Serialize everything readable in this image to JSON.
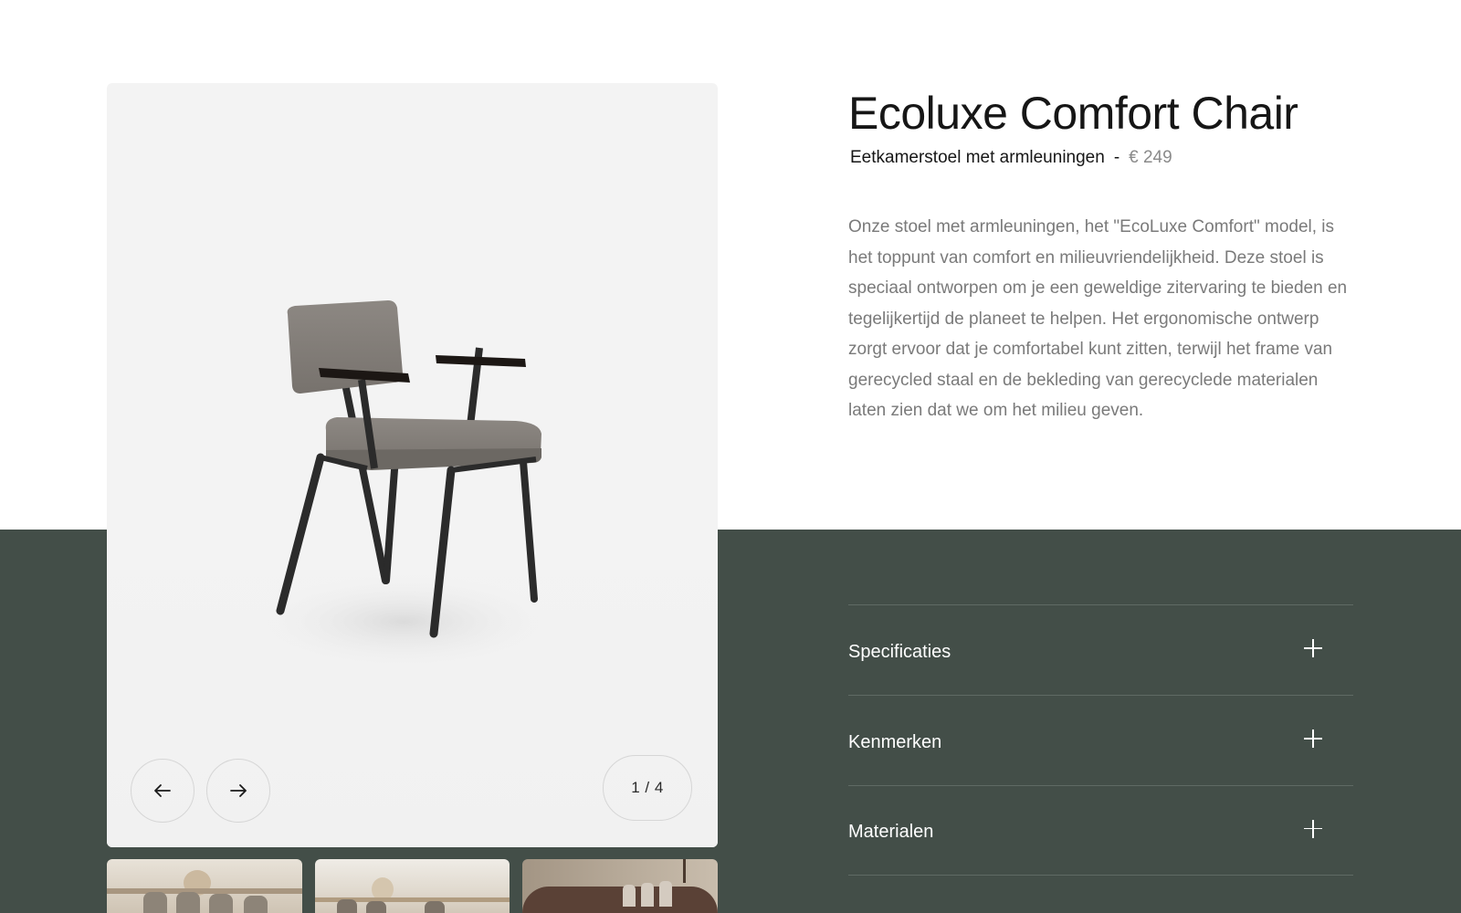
{
  "product": {
    "title": "Ecoluxe Comfort Chair",
    "subtitle": "Eetkamerstoel met armleuningen",
    "separator": "-",
    "price": "€ 249",
    "description": "Onze stoel met armleuningen, het \"EcoLuxe Comfort\" model, is het toppunt van comfort en milieuvriendelijkheid. Deze stoel is speciaal ontworpen om je een geweldige zitervaring te bieden en tegelijkertijd de planeet te helpen. Het ergonomische ontwerp zorgt ervoor dat je comfortabel kunt zitten, terwijl het frame van gerecycled staal en de bekleding van gerecyclede materialen laten zien dat we om het milieu geven."
  },
  "gallery": {
    "counter": "1 / 4",
    "prev_icon": "arrow-left-icon",
    "next_icon": "arrow-right-icon",
    "thumbnails": [
      "dining-table-scene-1",
      "dining-table-scene-2",
      "dining-table-scene-3"
    ]
  },
  "accordion": {
    "items": [
      {
        "label": "Specificaties",
        "icon": "plus-icon"
      },
      {
        "label": "Kenmerken",
        "icon": "plus-icon"
      },
      {
        "label": "Materialen",
        "icon": "plus-icon"
      }
    ]
  },
  "colors": {
    "accent_band": "#434e48",
    "gallery_bg": "#f3f3f3",
    "text_dark": "#161616",
    "text_muted": "#7a7a7a"
  }
}
